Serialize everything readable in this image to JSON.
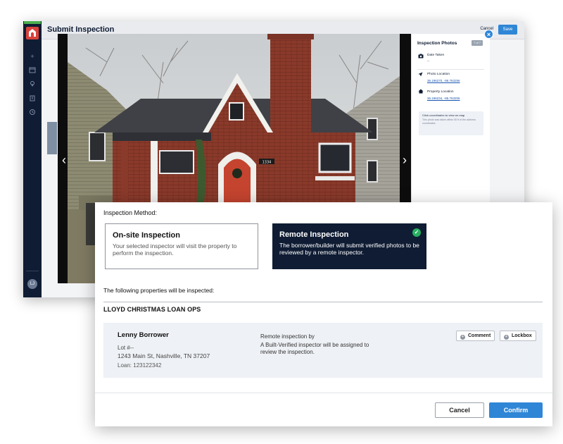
{
  "app": {
    "page_title": "Submit Inspection",
    "cancel_label": "Cancel",
    "save_label": "Save",
    "rail_avatar_initials": "LJ"
  },
  "photo_panel": {
    "title": "Inspection Photos",
    "count": "7 of 7",
    "date_taken_label": "Date Taken",
    "date_taken_value": "--",
    "photo_location_label": "Photo Location",
    "photo_location_value": "36.196270, -86.763256",
    "property_location_label": "Property Location",
    "property_location_value": "36.196234, -86.763206",
    "note_title": "Click coordinates to view on map",
    "note_text": "This photo was taken within 50 ft of the address coordinates.",
    "house_number": "1334"
  },
  "modal": {
    "method_label": "Inspection Method:",
    "onsite": {
      "title": "On-site Inspection",
      "description": "Your selected inspector will visit the property to perform the inspection."
    },
    "remote": {
      "title": "Remote Inspection",
      "description": "The borrower/builder will submit verified photos to be reviewed by a remote inspector.",
      "selected": true
    },
    "properties_label": "The following properties will be inspected:",
    "company": "LLOYD CHRISTMAS LOAN OPS",
    "property": {
      "name": "Lenny Borrower",
      "lot": "Lot #--",
      "address": "1243 Main St, Nashville, TN 37207",
      "loan": "Loan: 123122342",
      "remote_heading": "Remote inspection by",
      "remote_text": "A Built-Verified inspector will be assigned to review the inspection.",
      "comment_label": "Comment",
      "lockbox_label": "Lockbox"
    },
    "cancel_label": "Cancel",
    "confirm_label": "Confirm"
  },
  "colors": {
    "navy": "#0f1c33",
    "accent_blue": "#2f86d6",
    "check_green": "#27ae60",
    "brand_red": "#d9413a"
  },
  "icons": {
    "rail": [
      "plus-icon",
      "calendar-icon",
      "location-pin-icon",
      "building-icon",
      "history-icon"
    ],
    "photo_panel": [
      "camera-icon",
      "navigation-arrow-icon",
      "home-icon"
    ]
  }
}
